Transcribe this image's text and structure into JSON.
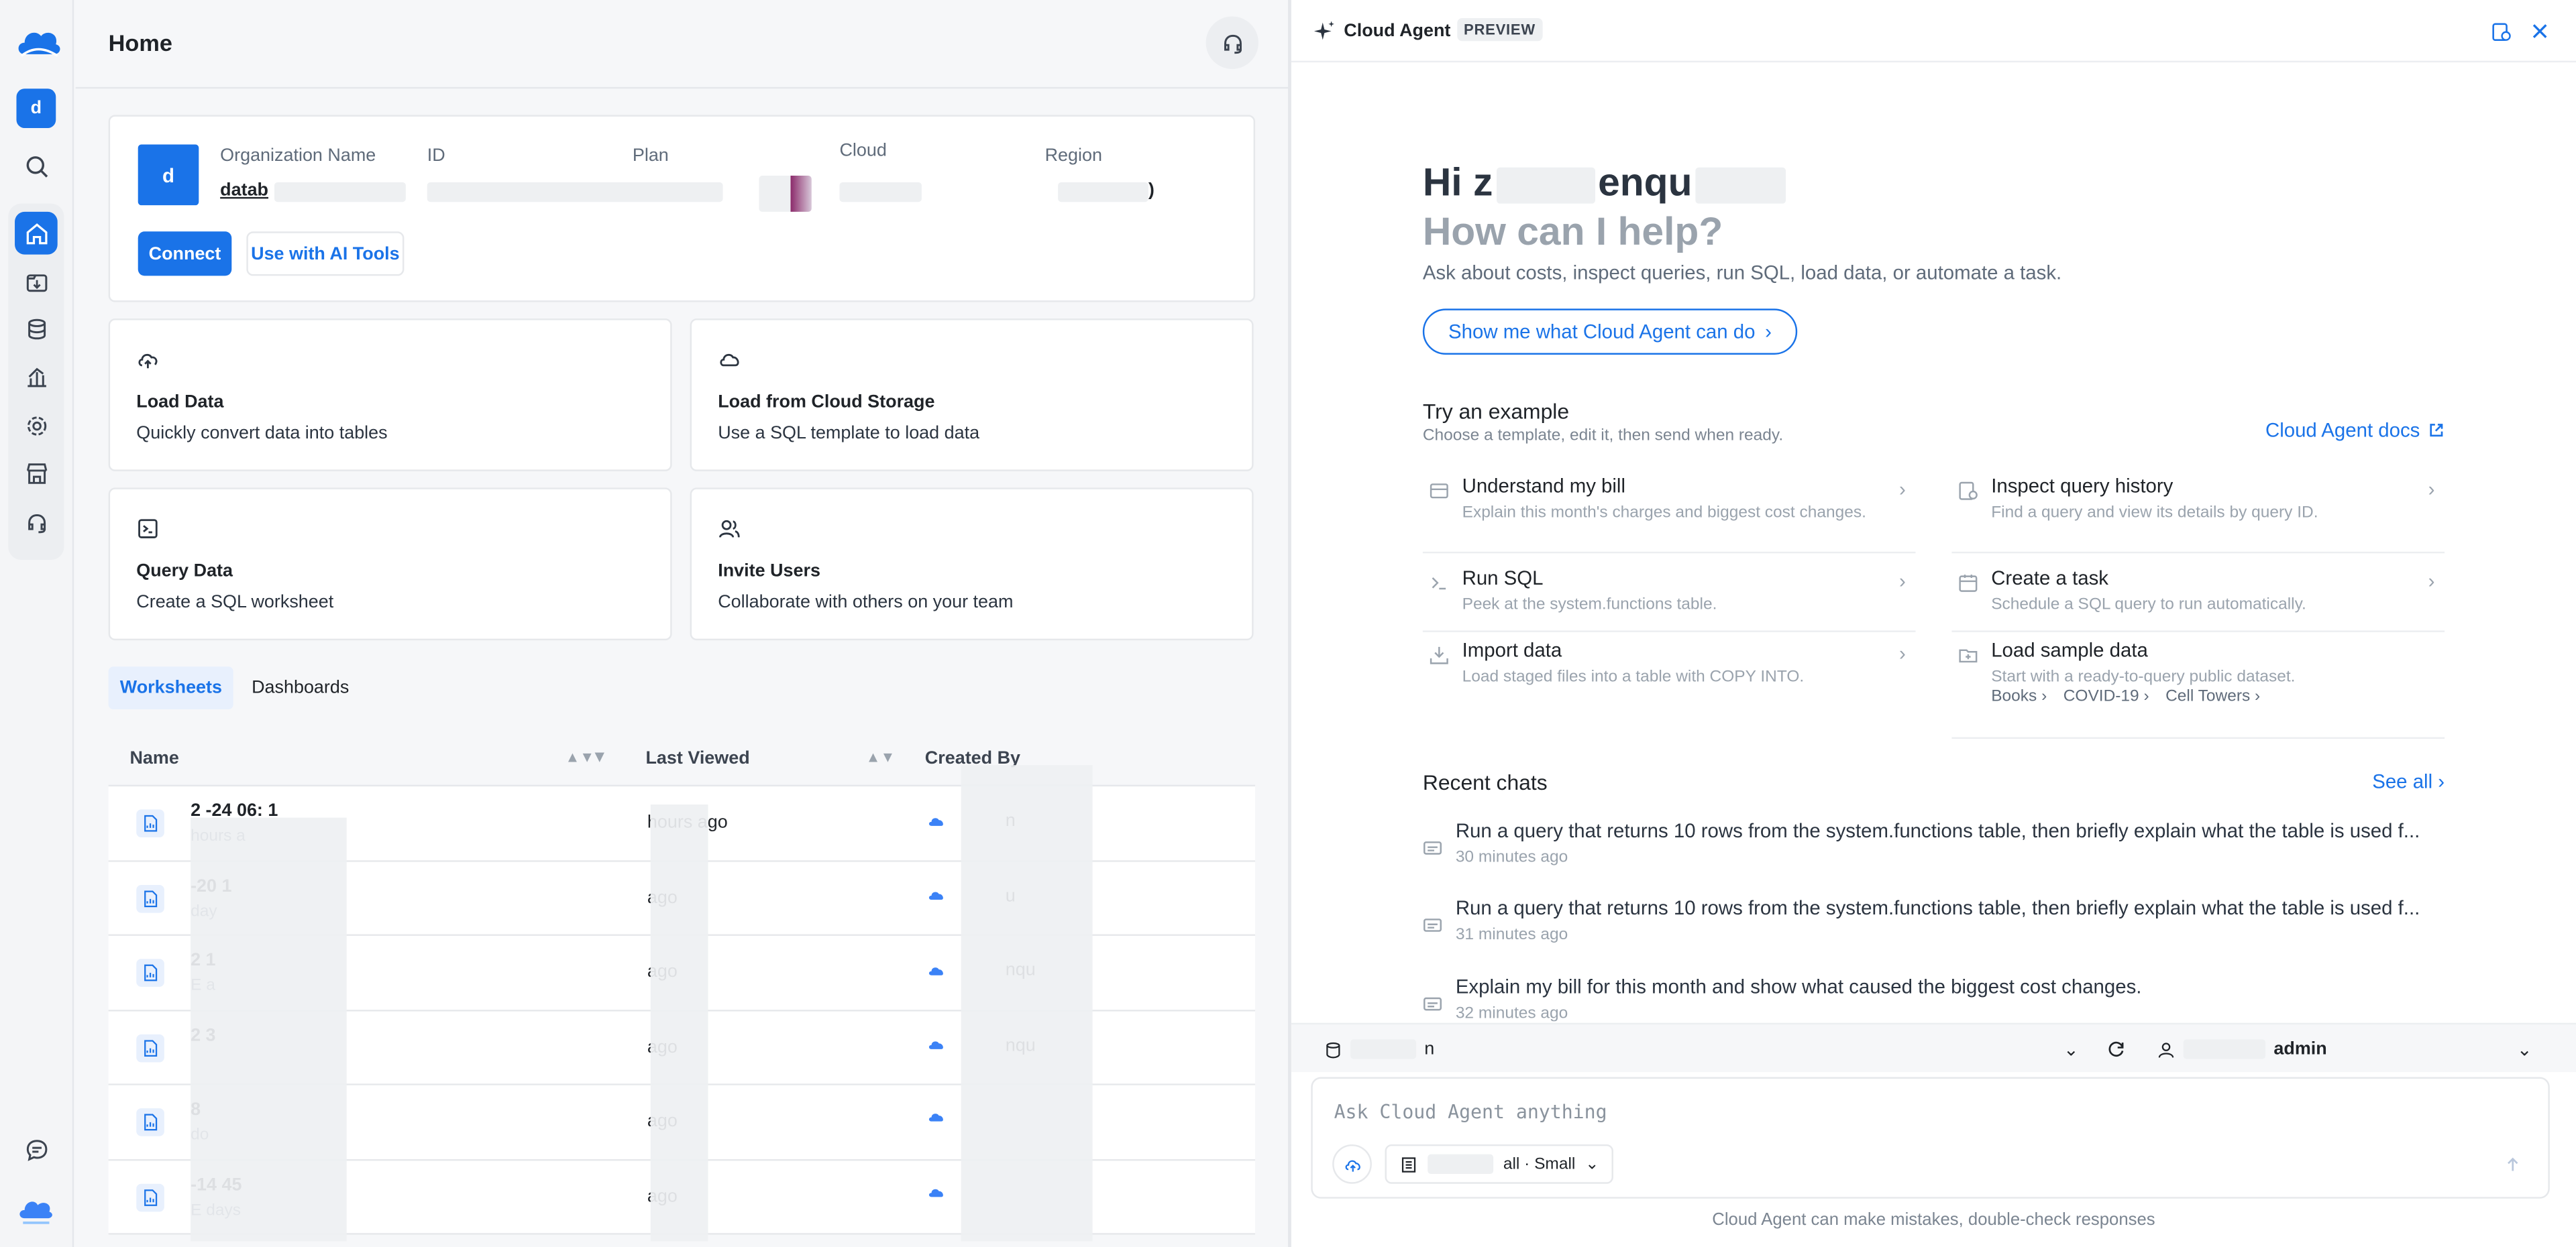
{
  "rail": {
    "org_initial": "d",
    "icons": [
      "search-icon",
      "home-icon",
      "data-import-icon",
      "database-icon",
      "chart-icon",
      "settings-icon",
      "marketplace-icon",
      "support-icon",
      "chat-icon"
    ]
  },
  "header": {
    "title": "Home"
  },
  "org": {
    "avatar": "d",
    "labels": {
      "name": "Organization Name",
      "id": "ID",
      "plan": "Plan",
      "cloud": "Cloud",
      "region": "Region"
    },
    "values": {
      "name": "datab",
      "region_tail": ")"
    },
    "connect_label": "Connect",
    "ai_tools_label": "Use with AI Tools"
  },
  "quick_actions": [
    {
      "title": "Load Data",
      "desc": "Quickly convert data into tables",
      "icon": "cloud-upload-icon"
    },
    {
      "title": "Load from Cloud Storage",
      "desc": "Use a SQL template to load data",
      "icon": "cloud-icon"
    },
    {
      "title": "Query Data",
      "desc": "Create a SQL worksheet",
      "icon": "terminal-icon"
    },
    {
      "title": "Invite Users",
      "desc": "Collaborate with others on your team",
      "icon": "users-icon"
    }
  ],
  "tabs": [
    "Worksheets",
    "Dashboards"
  ],
  "table": {
    "headers": {
      "name": "Name",
      "last_viewed": "Last Viewed",
      "created_by": "Created By"
    },
    "rows": [
      {
        "name": "2 -24 06: 1",
        "sub": "hours a",
        "last_viewed": "hours ago",
        "created_by": "n"
      },
      {
        "name": "-20 1",
        "sub": "day",
        "last_viewed": "ago",
        "created_by": "u"
      },
      {
        "name": "2 1",
        "sub": "E a",
        "last_viewed": "ago",
        "created_by": "nqu"
      },
      {
        "name": "2 3",
        "sub": "",
        "last_viewed": "ago",
        "created_by": "nqu"
      },
      {
        "name": "8",
        "sub": "do",
        "last_viewed": "ago",
        "created_by": ""
      },
      {
        "name": "-14 45",
        "sub": "E days",
        "last_viewed": "ago",
        "created_by": ""
      }
    ]
  },
  "agent": {
    "title": "Cloud Agent",
    "badge": "PREVIEW",
    "greeting": "Hi z",
    "greeting_tail": "enqu",
    "help": "How can I help?",
    "subtitle": "Ask about costs, inspect queries, run SQL, load data, or automate a task.",
    "show_btn": "Show me what Cloud Agent can do",
    "try_title": "Try an example",
    "try_sub": "Choose a template, edit it, then send when ready.",
    "docs_link": "Cloud Agent docs",
    "examples": [
      {
        "title": "Understand my bill",
        "desc": "Explain this month's charges and biggest cost changes.",
        "icon": "bill-icon"
      },
      {
        "title": "Inspect query history",
        "desc": "Find a query and view its details by query ID.",
        "icon": "history-icon"
      },
      {
        "title": "Run SQL",
        "desc": "Peek at the system.functions table.",
        "icon": "terminal-icon"
      },
      {
        "title": "Create a task",
        "desc": "Schedule a SQL query to run automatically.",
        "icon": "calendar-icon"
      },
      {
        "title": "Import data",
        "desc": "Load staged files into a table with COPY INTO.",
        "icon": "import-icon"
      },
      {
        "title": "Load sample data",
        "desc": "Start with a ready-to-query public dataset.",
        "icon": "folder-icon"
      }
    ],
    "sample_chips": [
      "Books",
      "COVID-19",
      "Cell Towers"
    ],
    "recent_title": "Recent chats",
    "see_all": "See all",
    "chats": [
      {
        "text": "Run a query that returns 10 rows from the system.functions table, then briefly explain what the table is used f...",
        "time": "30 minutes ago"
      },
      {
        "text": "Run a query that returns 10 rows from the system.functions table, then briefly explain what the table is used f...",
        "time": "31 minutes ago"
      },
      {
        "text": "Explain my bill for this month and show what caused the biggest cost changes.",
        "time": "32 minutes ago"
      }
    ],
    "ctx": {
      "database": "n",
      "role": "admin"
    },
    "placeholder": "Ask Cloud Agent anything",
    "warehouse": "all · Small",
    "disclaimer": "Cloud Agent can make mistakes, double-check responses"
  }
}
